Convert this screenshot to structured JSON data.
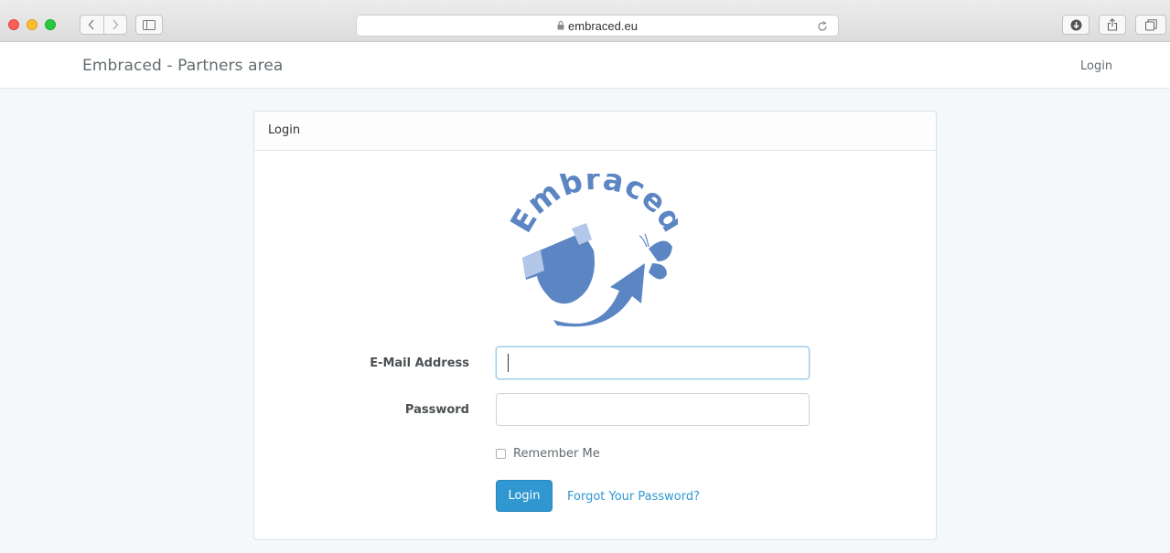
{
  "browser": {
    "url": "embraced.eu"
  },
  "navbar": {
    "brand": "Embraced - Partners area",
    "login_link": "Login"
  },
  "card": {
    "header": "Login",
    "logo_text": "Embraced",
    "email_label": "E-Mail Address",
    "email_value": "",
    "password_label": "Password",
    "password_value": "",
    "remember_label": "Remember Me",
    "remember_checked": false,
    "submit_label": "Login",
    "forgot_link": "Forgot Your Password?"
  },
  "colors": {
    "accent": "#3097d1",
    "logo_blue": "#5b86c3",
    "logo_light": "#b3c7e8"
  },
  "icons": [
    "back-icon",
    "forward-icon",
    "sidebar-icon",
    "lock-icon",
    "reload-icon",
    "download-icon",
    "share-icon",
    "tabs-icon"
  ]
}
